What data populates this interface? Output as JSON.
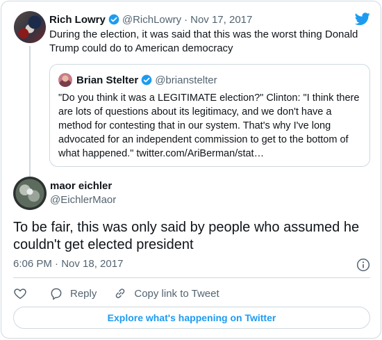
{
  "referenced_tweet": {
    "author_name": "Rich Lowry",
    "handle": "@RichLowry",
    "separator": "·",
    "date": "Nov 17, 2017",
    "text": "During the election, it was said that this was the worst thing Donald Trump could do to American democracy"
  },
  "quoted_tweet": {
    "author_name": "Brian Stelter",
    "handle": "@brianstelter",
    "text": "\"Do you think it was a LEGITIMATE election?\" Clinton: \"I think there are lots of questions about its legitimacy, and we don't have a method for contesting that in our system. That's why I've long advocated for an independent commission to get to the bottom of what happened.\" twitter.com/AriBerman/stat…"
  },
  "main_tweet": {
    "author_name": "maor eichler",
    "handle": "@EichlerMaor",
    "text": "To be fair, this was only said by people who assumed he couldn't get elected president",
    "timestamp": "6:06 PM · Nov 18, 2017"
  },
  "actions": {
    "reply_label": "Reply",
    "copy_link_label": "Copy link to Tweet"
  },
  "explore_label": "Explore what's happening on Twitter",
  "icons": [
    "twitter-bird-icon",
    "verified-badge-icon",
    "info-icon",
    "heart-icon",
    "reply-icon",
    "link-icon"
  ],
  "colors": {
    "brand": "#1d9bf0",
    "text": "#0f1419",
    "muted": "#536471",
    "border": "#cfd9de"
  }
}
